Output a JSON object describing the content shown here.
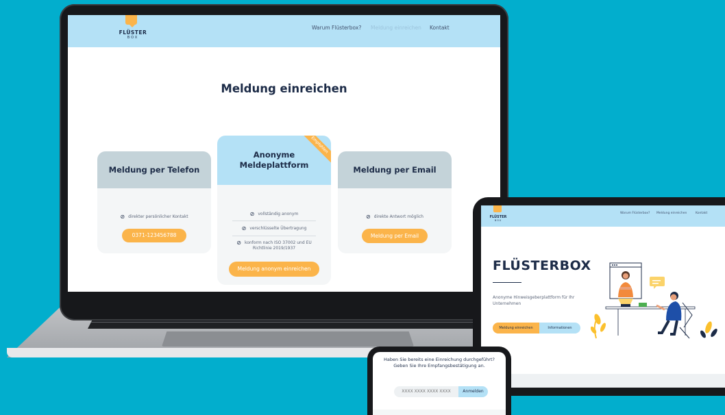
{
  "laptop": {
    "logo": {
      "name": "FLÜSTER",
      "sub": "BOX"
    },
    "nav": [
      "Warum Flüsterbox?",
      "Meldung einreichen",
      "Kontakt"
    ],
    "title": "Meldung einreichen",
    "cards": [
      {
        "heading": "Meldung per Telefon",
        "features": [
          "direkter persönlicher Kontakt"
        ],
        "button": "0371-123456788"
      },
      {
        "heading": "Anonyme Meldeplattform",
        "ribbon": "Empfohlen",
        "features": [
          "vollständig anonym",
          "verschlüsselte Übertragung",
          "konform nach ISO 37002 und EU Richtlinie 2019/1937"
        ],
        "button": "Meldung anonym einreichen"
      },
      {
        "heading": "Meldung per Email",
        "features": [
          "direkte Antwort möglich"
        ],
        "button": "Meldung per Email"
      }
    ]
  },
  "tablet": {
    "logo": {
      "name": "FLÜSTER",
      "sub": "BOX"
    },
    "nav": [
      "Warum Flüsterbox?",
      "Meldung einreichen",
      "Kontakt"
    ],
    "hero_title": "FLÜSTERBOX",
    "hero_subtitle": "Anonyme Hinweisgeberplattform für Ihr Unternehmen",
    "button_primary": "Meldung einreichen",
    "button_secondary": "Informationen"
  },
  "phone": {
    "prompt": "Haben Sie bereits eine Einreichung durchgeführt? Geben Sie Ihre Empfangsbestätigung an.",
    "input_placeholder": "XXXX XXXX XXXX XXXX",
    "button": "Anmelden"
  },
  "colors": {
    "background": "#02aecd",
    "header": "#b4e1f6",
    "accent": "#fbb44a",
    "card_head_grey": "#c4d3d9",
    "text_dark": "#1c2b47"
  }
}
